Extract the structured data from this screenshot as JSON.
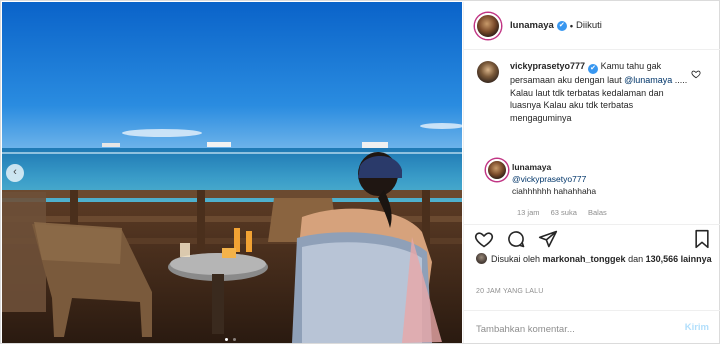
{
  "header": {
    "username": "lunamaya",
    "verified_mark": "✔",
    "separator": "•",
    "follow_status": "Diikuti"
  },
  "comment": {
    "username": "vickyprasetyo777",
    "verified_mark": "✔",
    "text_before": " Kamu tahu gak persamaan aku dengan laut ",
    "mention": "@lunamaya",
    "text_after": " ..... Kalau laut tdk terbatas kedalaman dan luasnya Kalau aku tdk terbatas mengaguminya",
    "like_icon": "heart-outline-icon"
  },
  "reply": {
    "username": "lunamaya",
    "mention": "@vickyprasetyo777",
    "text": "ciahhhhhh hahahhaha",
    "time": "13 jam",
    "likes": "63 suka",
    "reply_label": "Balas"
  },
  "actions": {
    "icons": [
      "heart-icon",
      "comment-icon",
      "share-icon",
      "bookmark-icon"
    ]
  },
  "likes": {
    "prefix": "Disukai oleh ",
    "user": "markonah_tonggek",
    "middle": " dan ",
    "count": "130,566 lainnya"
  },
  "timestamp": "20 JAM YANG LALU",
  "add_comment": {
    "placeholder": "Tambahkan komentar...",
    "post_label": "Kirim"
  },
  "carousel": {
    "prev_arrow": "‹",
    "slides": 2,
    "active": 1
  },
  "colors": {
    "link": "#003569",
    "verified": "#3897f0",
    "muted": "#8e8e8e",
    "post_disabled": "#b2dffc"
  }
}
